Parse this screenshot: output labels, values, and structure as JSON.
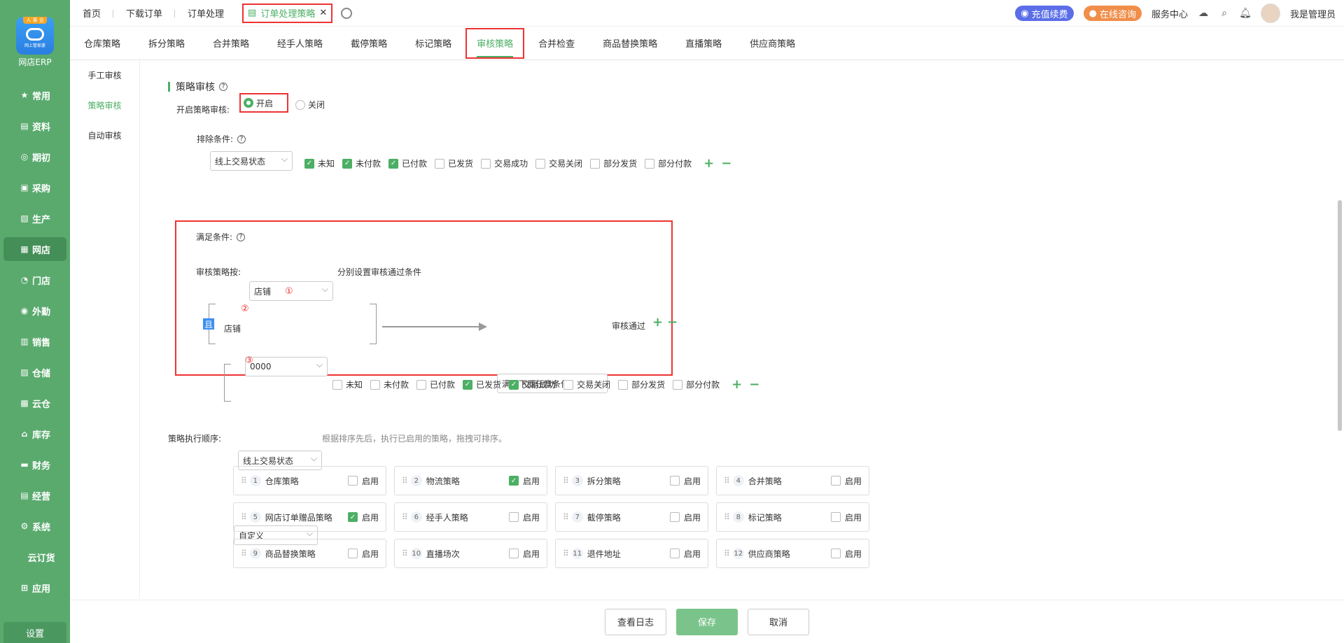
{
  "brand": {
    "badge": "人 事 业",
    "sub": "网上管家婆",
    "name": "网店ERP"
  },
  "nav": [
    {
      "label": "常用",
      "icon": "★"
    },
    {
      "label": "资料",
      "icon": "▤"
    },
    {
      "label": "期初",
      "icon": "◎"
    },
    {
      "label": "采购",
      "icon": "▣"
    },
    {
      "label": "生产",
      "icon": "▧"
    },
    {
      "label": "网店",
      "icon": "▦"
    },
    {
      "label": "门店",
      "icon": "◔"
    },
    {
      "label": "外勤",
      "icon": "◉"
    },
    {
      "label": "销售",
      "icon": "▥"
    },
    {
      "label": "仓储",
      "icon": "▨"
    },
    {
      "label": "云仓",
      "icon": "▩"
    },
    {
      "label": "库存",
      "icon": "⌂"
    },
    {
      "label": "财务",
      "icon": "▬"
    },
    {
      "label": "经营",
      "icon": "▤"
    },
    {
      "label": "系统",
      "icon": "⚙"
    },
    {
      "label": "云订货",
      "icon": ""
    },
    {
      "label": "应用",
      "icon": "⊞"
    }
  ],
  "settings_label": "设置",
  "tabs": {
    "home": "首页",
    "download": "下载订单",
    "process": "订单处理",
    "active": "订单处理策略",
    "close": "✕"
  },
  "topright": {
    "recharge": "充值续费",
    "consult": "在线咨询",
    "service": "服务中心",
    "user": "我是管理员"
  },
  "subtabs": [
    "仓库策略",
    "拆分策略",
    "合并策略",
    "经手人策略",
    "截停策略",
    "标记策略",
    "审核策略",
    "合并检查",
    "商品替换策略",
    "直播策略",
    "供应商策略"
  ],
  "leftmenu": [
    "手工审核",
    "策略审核",
    "自动审核"
  ],
  "section": {
    "title": "策略审核",
    "q": "?"
  },
  "enable": {
    "label": "开启策略审核:",
    "on": "开启",
    "off": "关闭"
  },
  "exclude": {
    "label": "排除条件:",
    "select": "线上交易状态",
    "options": [
      {
        "t": "未知",
        "c": true
      },
      {
        "t": "未付款",
        "c": true
      },
      {
        "t": "已付款",
        "c": true
      },
      {
        "t": "已发货",
        "c": false
      },
      {
        "t": "交易成功",
        "c": false
      },
      {
        "t": "交易关闭",
        "c": false
      },
      {
        "t": "部分发货",
        "c": false
      },
      {
        "t": "部分付款",
        "c": false
      }
    ]
  },
  "satisfy": {
    "label": "满足条件:",
    "by_label": "审核策略按:",
    "by_value": "店铺",
    "n1": "①",
    "n2": "②",
    "n3": "③",
    "by_hint": "分别设置审核通过条件",
    "and": "且",
    "shop_label": "店铺",
    "shop_value": "0000",
    "cond_select": "满足下面任意条件",
    "pass": "审核通过",
    "status_select": "线上交易状态",
    "options": [
      {
        "t": "未知",
        "c": false
      },
      {
        "t": "未付款",
        "c": false
      },
      {
        "t": "已付款",
        "c": false
      },
      {
        "t": "已发货",
        "c": true
      },
      {
        "t": "交易成功",
        "c": true
      },
      {
        "t": "交易关闭",
        "c": false
      },
      {
        "t": "部分发货",
        "c": false
      },
      {
        "t": "部分付款",
        "c": false
      }
    ]
  },
  "order": {
    "label": "策略执行顺序:",
    "value": "自定义",
    "hint": "根据排序先后，执行已启用的策略，拖拽可排序。"
  },
  "strategies": [
    {
      "n": "1",
      "name": "仓库策略",
      "on": false
    },
    {
      "n": "2",
      "name": "物流策略",
      "on": true
    },
    {
      "n": "3",
      "name": "拆分策略",
      "on": false
    },
    {
      "n": "4",
      "name": "合并策略",
      "on": false
    },
    {
      "n": "5",
      "name": "网店订单赠品策略",
      "on": true
    },
    {
      "n": "6",
      "name": "经手人策略",
      "on": false
    },
    {
      "n": "7",
      "name": "截停策略",
      "on": false
    },
    {
      "n": "8",
      "name": "标记策略",
      "on": false
    },
    {
      "n": "9",
      "name": "商品替换策略",
      "on": false
    },
    {
      "n": "10",
      "name": "直播场次",
      "on": false
    },
    {
      "n": "11",
      "name": "退件地址",
      "on": false
    },
    {
      "n": "12",
      "name": "供应商策略",
      "on": false
    }
  ],
  "enable_word": "启用",
  "footer": {
    "log": "查看日志",
    "save": "保存",
    "cancel": "取消"
  },
  "colors": {
    "green": "#4caf64",
    "sidebar": "#5aaa6e",
    "red": "#e33"
  }
}
